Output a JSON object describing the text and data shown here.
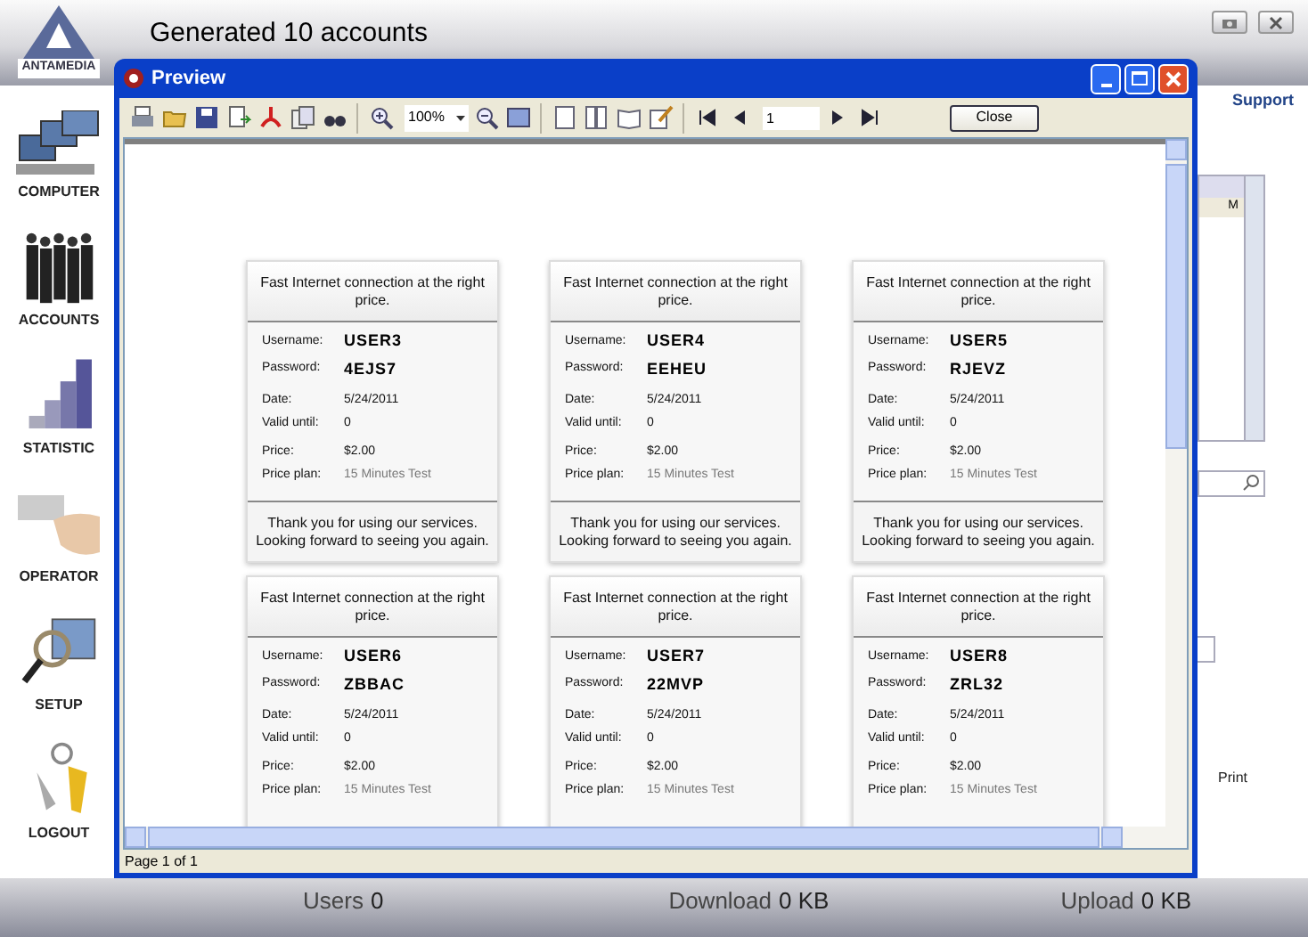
{
  "app": {
    "logo_text": "ANTAMEDIA",
    "title": "Generated 10 accounts",
    "support": "Support",
    "table_header": "M",
    "print": "Print"
  },
  "sidebar": [
    {
      "kind": "computer",
      "label": "COMPUTER"
    },
    {
      "kind": "people",
      "label": "ACCOUNTS"
    },
    {
      "kind": "chart",
      "label": "STATISTIC"
    },
    {
      "kind": "card",
      "label": "OPERATOR"
    },
    {
      "kind": "magnifier",
      "label": "SETUP"
    },
    {
      "kind": "keys",
      "label": "LOGOUT"
    }
  ],
  "preview": {
    "title": "Preview",
    "zoom": "100%",
    "page": "1",
    "close": "Close",
    "status": "Page 1 of 1",
    "cards": [
      {
        "header": "Fast Internet connection at the right price.",
        "groups": [
          [
            {
              "label": "Username:",
              "value": "USER3",
              "kind": "strong"
            },
            {
              "label": "Password:",
              "value": "4EJS7",
              "kind": "strong"
            }
          ],
          [
            {
              "label": "Date:",
              "value": "5/24/2011",
              "kind": "plain"
            },
            {
              "label": "Valid until:",
              "value": "0",
              "kind": "plain"
            }
          ],
          [
            {
              "label": "Price:",
              "value": "$2.00",
              "kind": "plain"
            },
            {
              "label": "Price plan:",
              "value": "15 Minutes Test",
              "kind": "muted"
            }
          ]
        ],
        "footer": "Thank you for using our services. Looking forward to seeing you again."
      },
      {
        "header": "Fast Internet connection at the right price.",
        "groups": [
          [
            {
              "label": "Username:",
              "value": "USER4",
              "kind": "strong"
            },
            {
              "label": "Password:",
              "value": "EEHEU",
              "kind": "strong"
            }
          ],
          [
            {
              "label": "Date:",
              "value": "5/24/2011",
              "kind": "plain"
            },
            {
              "label": "Valid until:",
              "value": "0",
              "kind": "plain"
            }
          ],
          [
            {
              "label": "Price:",
              "value": "$2.00",
              "kind": "plain"
            },
            {
              "label": "Price plan:",
              "value": "15 Minutes Test",
              "kind": "muted"
            }
          ]
        ],
        "footer": "Thank you for using our services. Looking forward to seeing you again."
      },
      {
        "header": "Fast Internet connection at the right price.",
        "groups": [
          [
            {
              "label": "Username:",
              "value": "USER5",
              "kind": "strong"
            },
            {
              "label": "Password:",
              "value": "RJEVZ",
              "kind": "strong"
            }
          ],
          [
            {
              "label": "Date:",
              "value": "5/24/2011",
              "kind": "plain"
            },
            {
              "label": "Valid until:",
              "value": "0",
              "kind": "plain"
            }
          ],
          [
            {
              "label": "Price:",
              "value": "$2.00",
              "kind": "plain"
            },
            {
              "label": "Price plan:",
              "value": "15 Minutes Test",
              "kind": "muted"
            }
          ]
        ],
        "footer": "Thank you for using our services. Looking forward to seeing you again."
      },
      {
        "header": "Fast Internet connection at the right price.",
        "groups": [
          [
            {
              "label": "Username:",
              "value": "USER6",
              "kind": "strong"
            },
            {
              "label": "Password:",
              "value": "ZBBAC",
              "kind": "strong"
            }
          ],
          [
            {
              "label": "Date:",
              "value": "5/24/2011",
              "kind": "plain"
            },
            {
              "label": "Valid until:",
              "value": "0",
              "kind": "plain"
            }
          ],
          [
            {
              "label": "Price:",
              "value": "$2.00",
              "kind": "plain"
            },
            {
              "label": "Price plan:",
              "value": "15 Minutes Test",
              "kind": "muted"
            }
          ]
        ]
      },
      {
        "header": "Fast Internet connection at the right price.",
        "groups": [
          [
            {
              "label": "Username:",
              "value": "USER7",
              "kind": "strong"
            },
            {
              "label": "Password:",
              "value": "22MVP",
              "kind": "strong"
            }
          ],
          [
            {
              "label": "Date:",
              "value": "5/24/2011",
              "kind": "plain"
            },
            {
              "label": "Valid until:",
              "value": "0",
              "kind": "plain"
            }
          ],
          [
            {
              "label": "Price:",
              "value": "$2.00",
              "kind": "plain"
            },
            {
              "label": "Price plan:",
              "value": "15 Minutes Test",
              "kind": "muted"
            }
          ]
        ]
      },
      {
        "header": "Fast Internet connection at the right price.",
        "groups": [
          [
            {
              "label": "Username:",
              "value": "USER8",
              "kind": "strong"
            },
            {
              "label": "Password:",
              "value": "ZRL32",
              "kind": "strong"
            }
          ],
          [
            {
              "label": "Date:",
              "value": "5/24/2011",
              "kind": "plain"
            },
            {
              "label": "Valid until:",
              "value": "0",
              "kind": "plain"
            }
          ],
          [
            {
              "label": "Price:",
              "value": "$2.00",
              "kind": "plain"
            },
            {
              "label": "Price plan:",
              "value": "15 Minutes Test",
              "kind": "muted"
            }
          ]
        ]
      }
    ]
  },
  "stats": [
    {
      "label": "Users",
      "value": "0"
    },
    {
      "label": "Download",
      "value": "0 KB"
    },
    {
      "label": "Upload",
      "value": "0 KB"
    }
  ]
}
